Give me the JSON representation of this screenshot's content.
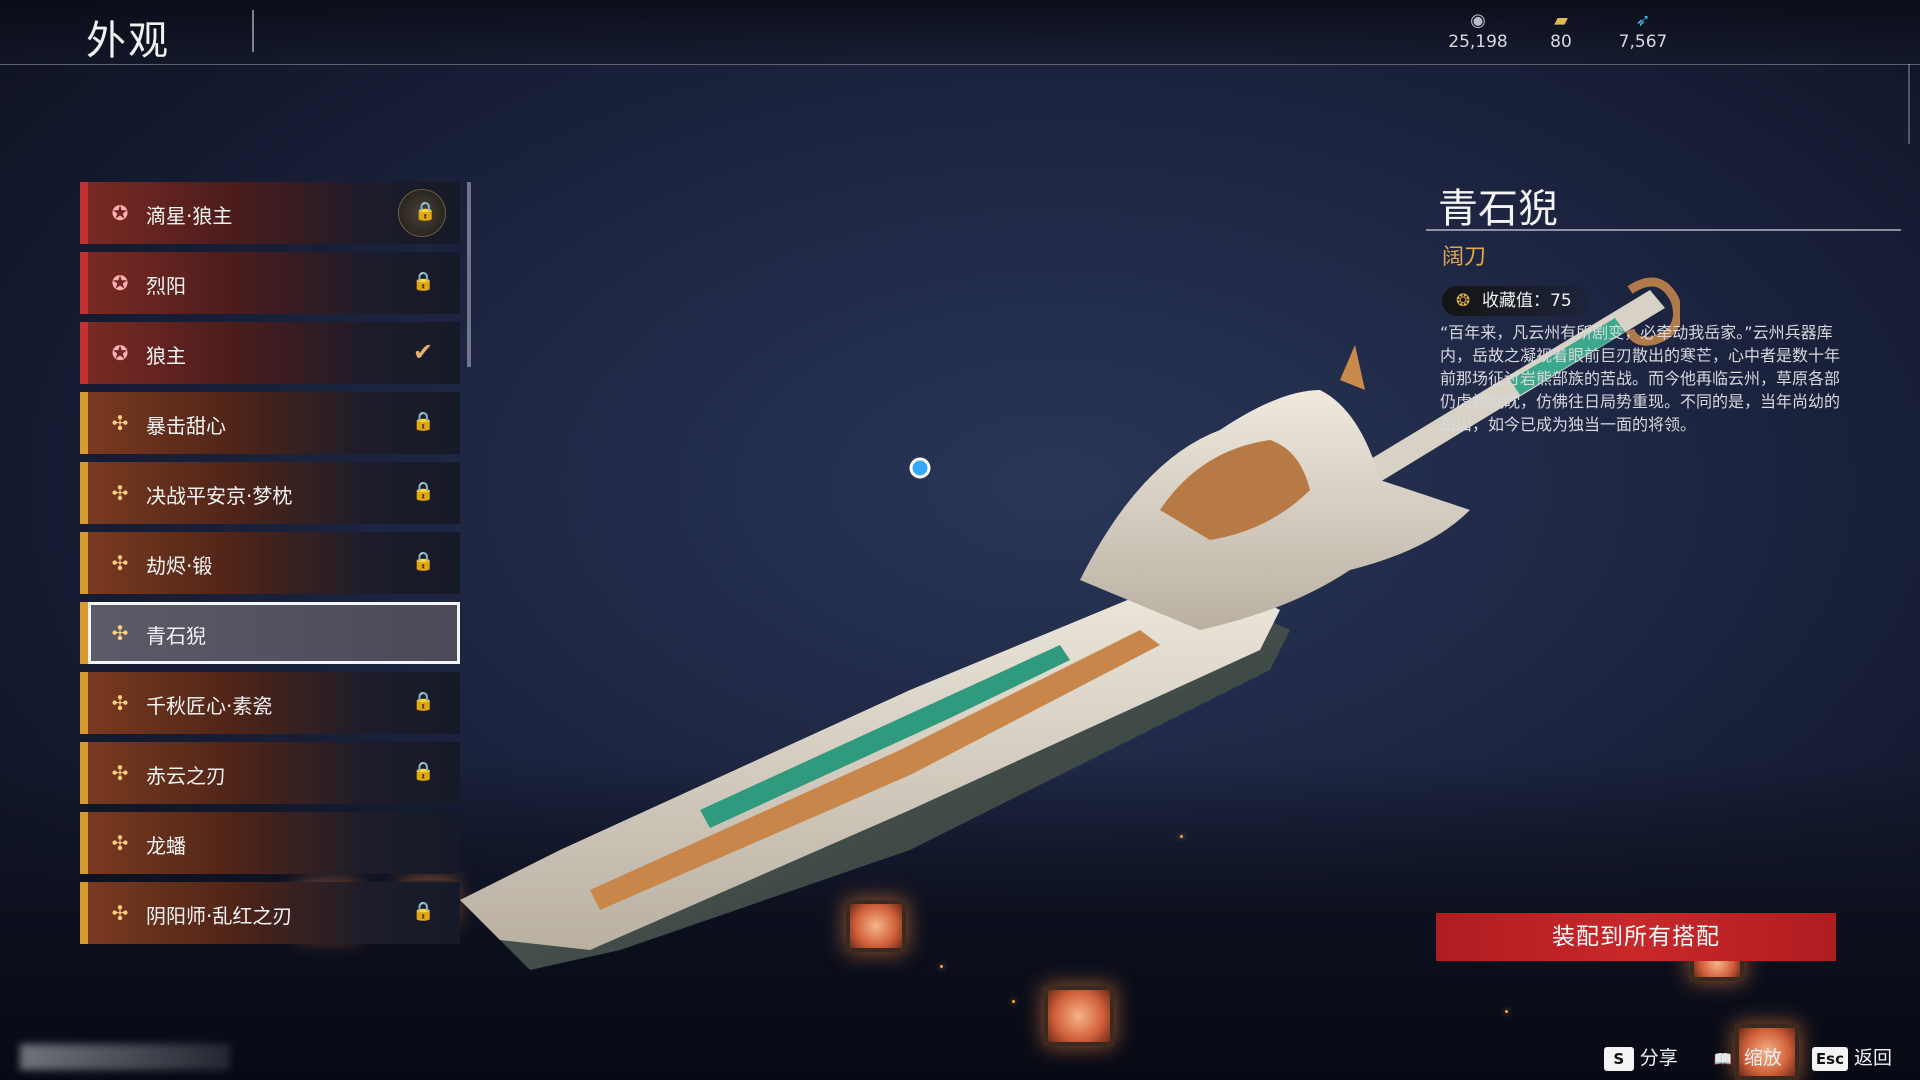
{
  "header": {
    "title": "外观"
  },
  "currencies": [
    {
      "icon": "silver-coin-icon",
      "value": "25,198"
    },
    {
      "icon": "gold-ticket-icon",
      "value": "80"
    },
    {
      "icon": "feather-token-icon",
      "value": "7,567"
    }
  ],
  "skins": [
    {
      "name": "滴星·狼主",
      "grade": "red",
      "state": "locked-badge"
    },
    {
      "name": "烈阳",
      "grade": "red",
      "state": "locked"
    },
    {
      "name": "狼主",
      "grade": "red",
      "state": "equipped"
    },
    {
      "name": "暴击甜心",
      "grade": "gold",
      "state": "locked"
    },
    {
      "name": "决战平安京·梦枕",
      "grade": "gold",
      "state": "locked"
    },
    {
      "name": "劫烬·锻",
      "grade": "gold",
      "state": "locked"
    },
    {
      "name": "青石猊",
      "grade": "gold",
      "state": "selected"
    },
    {
      "name": "千秋匠心·素瓷",
      "grade": "gold",
      "state": "locked"
    },
    {
      "name": "赤云之刃",
      "grade": "gold",
      "state": "locked"
    },
    {
      "name": "龙蟠",
      "grade": "gold",
      "state": "none"
    },
    {
      "name": "阴阳师·乱红之刃",
      "grade": "gold",
      "state": "locked"
    }
  ],
  "detail": {
    "name": "青石猊",
    "type": "阔刀",
    "collection_label": "收藏值：75",
    "lore": "“百年来，凡云州有所剧变，必牵动我岳家。”云州兵器库内，岳故之凝视着眼前巨刃散出的寒芒，心中者是数十年前那场征讨岩熊部族的苦战。而今他再临云州，草原各部仍虎视眈眈，仿佛往日局势重现。不同的是，当年尚幼的岳山，如今已成为独当一面的将领。"
  },
  "actions": {
    "equip_all": "装配到所有搭配"
  },
  "hints": [
    {
      "key": "S",
      "label": "分享"
    },
    {
      "key": "📖",
      "label": "缩放"
    },
    {
      "key": "Esc",
      "label": "返回"
    }
  ]
}
